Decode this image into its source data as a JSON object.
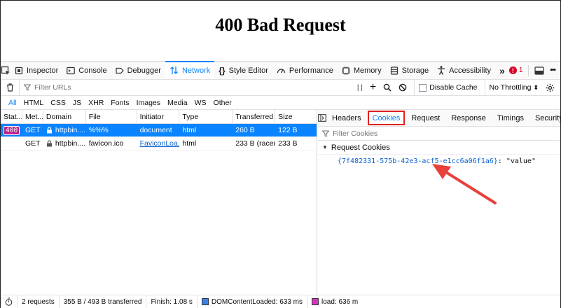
{
  "page": {
    "title": "400 Bad Request"
  },
  "toolbox": {
    "tabs": [
      {
        "label": "Inspector",
        "icon": "inspector-icon"
      },
      {
        "label": "Console",
        "icon": "console-icon"
      },
      {
        "label": "Debugger",
        "icon": "debugger-icon"
      },
      {
        "label": "Network",
        "icon": "network-icon",
        "active": true
      },
      {
        "label": "Style Editor",
        "icon": "style-editor-icon"
      },
      {
        "label": "Performance",
        "icon": "performance-icon"
      },
      {
        "label": "Memory",
        "icon": "memory-icon"
      },
      {
        "label": "Storage",
        "icon": "storage-icon"
      },
      {
        "label": "Accessibility",
        "icon": "accessibility-icon"
      }
    ],
    "more": "»",
    "error_count": "1",
    "options": "•••"
  },
  "filterbar": {
    "placeholder": "Filter URLs",
    "pause": "| |",
    "disable_cache": "Disable Cache",
    "throttle": "No Throttling",
    "throttle_arrow": "⬍"
  },
  "types": [
    "All",
    "HTML",
    "CSS",
    "JS",
    "XHR",
    "Fonts",
    "Images",
    "Media",
    "WS",
    "Other"
  ],
  "table": {
    "headers": [
      "Stat...",
      "Met...",
      "Domain",
      "File",
      "Initiator",
      "Type",
      "Transferred",
      "Size"
    ],
    "rows": [
      {
        "status": "400",
        "method": "GET",
        "domain": "httpbin....",
        "file": "%%%",
        "initiator": "document",
        "type": "html",
        "transferred": "260 B",
        "size": "122 B"
      },
      {
        "status": "",
        "method": "GET",
        "domain": "httpbin....",
        "file": "favicon.ico",
        "initiator": "FaviconLoa...",
        "type": "html",
        "transferred": "233 B (raced)",
        "size": "233 B"
      }
    ]
  },
  "details": {
    "tabs": [
      "Headers",
      "Cookies",
      "Request",
      "Response",
      "Timings",
      "Security"
    ],
    "active_tab": "Cookies",
    "filter_placeholder": "Filter Cookies",
    "section": "Request Cookies",
    "cookie": {
      "name": "{7f482331-575b-42e3-acf5-e1cc6a06f1a6}",
      "sep": ": ",
      "value": "\"value\""
    }
  },
  "footer": {
    "requests": "2 requests",
    "transferred": "355 B / 493 B transferred",
    "finish": "Finish: 1.08 s",
    "dcl": "DOMContentLoaded: 633 ms",
    "load": "load: 636 m",
    "dcl_color": "#3b82e8",
    "load_color": "#d236c0"
  },
  "colors": {
    "accent": "#0a84ff",
    "highlight_box": "#e02020",
    "arrow": "#e8403a"
  }
}
